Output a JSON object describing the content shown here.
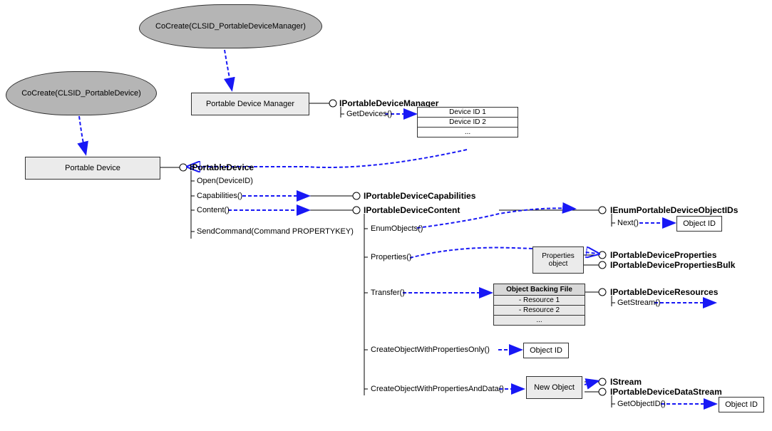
{
  "clouds": {
    "c1": "CoCreate(CLSID_PortableDevice)",
    "c2": "CoCreate(CLSID_PortableDeviceManager)"
  },
  "boxes": {
    "pdm": "Portable Device Manager",
    "pd": "Portable Device",
    "propObj": "Properties object",
    "newObj": "New Object"
  },
  "interfaces": {
    "ipdm": "IPortableDeviceManager",
    "ipd": "IPortableDevice",
    "ipdcap": "IPortableDeviceCapabilities",
    "ipdcont": "IPortableDeviceContent",
    "ienum": "IEnumPortableDeviceObjectIDs",
    "ipdprop": "IPortableDeviceProperties",
    "ipdpropb": "IPortableDevicePropertiesBulk",
    "ipdres": "IPortableDeviceResources",
    "istream": "IStream",
    "ipdds": "IPortableDeviceDataStream"
  },
  "methods": {
    "getdev": "GetDevices()",
    "open": "Open(DeviceID)",
    "cap": "Capabilities()",
    "cont": "Content()",
    "sendcmd": "SendCommand(Command PROPERTYKEY)",
    "enumobj": "EnumObjects()",
    "props": "Properties()",
    "transfer": "Transfer()",
    "cwpo": "CreateObjectWithPropertiesOnly()",
    "cwpad": "CreateObjectWithPropertiesAndData()",
    "next": "Next()",
    "getstream": "GetStream()",
    "getobjid": "GetObjectID()"
  },
  "devTable": {
    "r1": "Device ID 1",
    "r2": "Device ID 2",
    "r3": "..."
  },
  "resTable": {
    "hdr": "Object Backing File",
    "r1": "- Resource 1",
    "r2": "- Resource 2",
    "r3": "..."
  },
  "objid": "Object ID"
}
